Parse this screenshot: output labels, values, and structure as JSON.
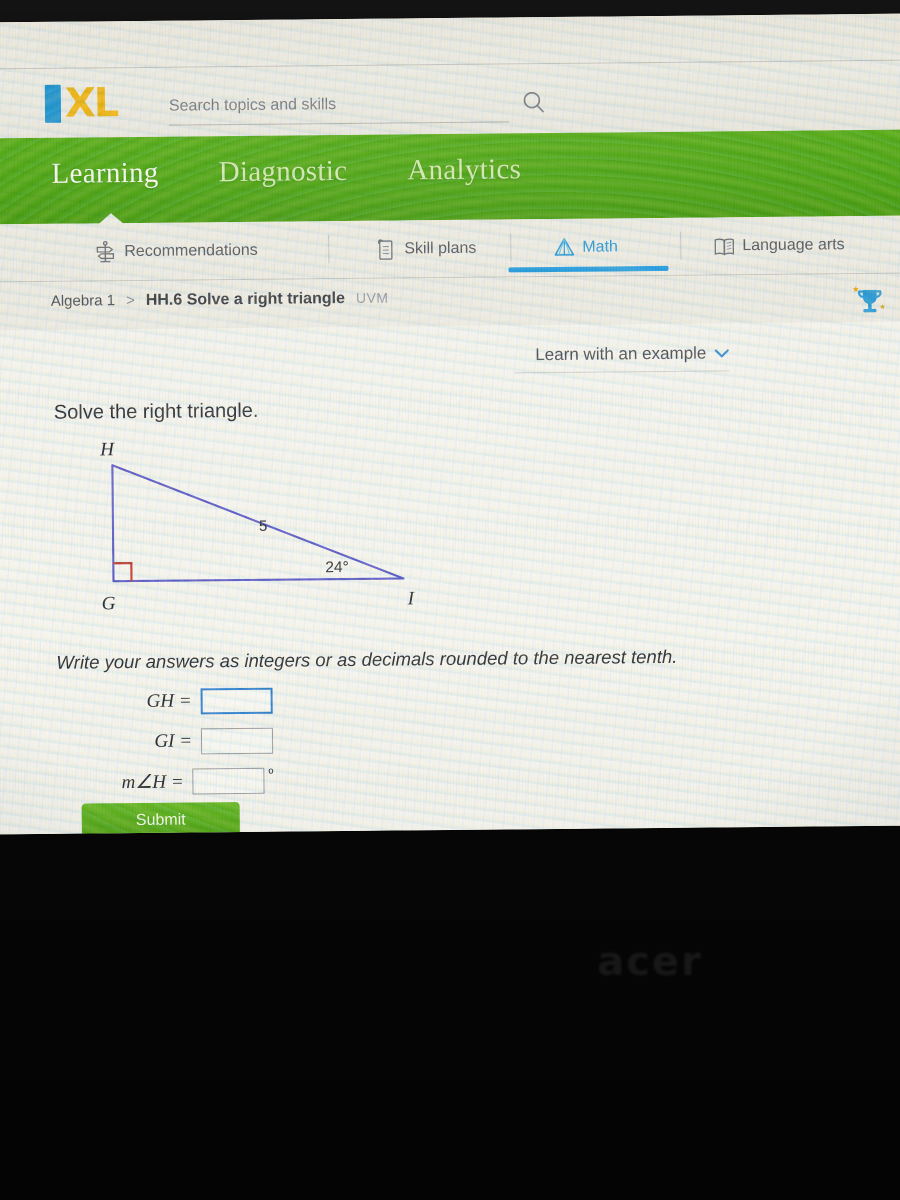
{
  "device": {
    "brand_watermark": "acer"
  },
  "browser_bar": {
    "logo_i": "I",
    "logo_xl": "XL",
    "logo_name": "ixl-logo",
    "search": {
      "placeholder": "Search topics and skills",
      "value": "",
      "icon": "search-icon"
    }
  },
  "green_nav": {
    "items": [
      {
        "label": "Learning",
        "active": true
      },
      {
        "label": "Diagnostic",
        "active": false
      },
      {
        "label": "Analytics",
        "active": false
      }
    ]
  },
  "subject_tabs": {
    "items": [
      {
        "label": "Recommendations",
        "icon": "signpost-icon",
        "active": false
      },
      {
        "label": "Skill plans",
        "icon": "clipboard-icon",
        "active": false
      },
      {
        "label": "Math",
        "icon": "pyramid-icon",
        "active": true
      },
      {
        "label": "Language arts",
        "icon": "open-book-icon",
        "active": false
      }
    ],
    "active_color": "#2196d6"
  },
  "breadcrumb": {
    "grade": "Algebra 1",
    "separator": ">",
    "skill": "HH.6 Solve a right triangle",
    "code": "UVM"
  },
  "awards": {
    "icon": "trophy-icon",
    "color": "#2a9ad6",
    "sparkle_color": "#e8a81c"
  },
  "question": {
    "learn_link": "Learn with an example",
    "learn_caret": "⌄",
    "prompt": "Solve the right triangle.",
    "note": "Write your answers as integers or as decimals rounded to the nearest tenth.",
    "figure": {
      "type": "right-triangle",
      "stroke_color": "#5a58c8",
      "right_angle_color": "#c1372c",
      "vertices": [
        {
          "name": "H",
          "position": "top-left"
        },
        {
          "name": "G",
          "position": "bottom-left"
        },
        {
          "name": "I",
          "position": "bottom-right"
        }
      ],
      "right_angle_at": "G",
      "side_labels": [
        {
          "label": "5",
          "side": "HI"
        }
      ],
      "angle_labels": [
        {
          "label": "24°",
          "at": "I"
        }
      ]
    },
    "answer_fields": [
      {
        "label": "GH =",
        "value": "",
        "unit": "",
        "focused": true
      },
      {
        "label": "GI =",
        "value": "",
        "unit": "",
        "focused": false
      },
      {
        "label": "m∠H =",
        "value": "",
        "unit": "º",
        "focused": false
      }
    ],
    "submit_label": "Submit"
  },
  "taskbar": {
    "app_icon": "chrome-icon"
  }
}
